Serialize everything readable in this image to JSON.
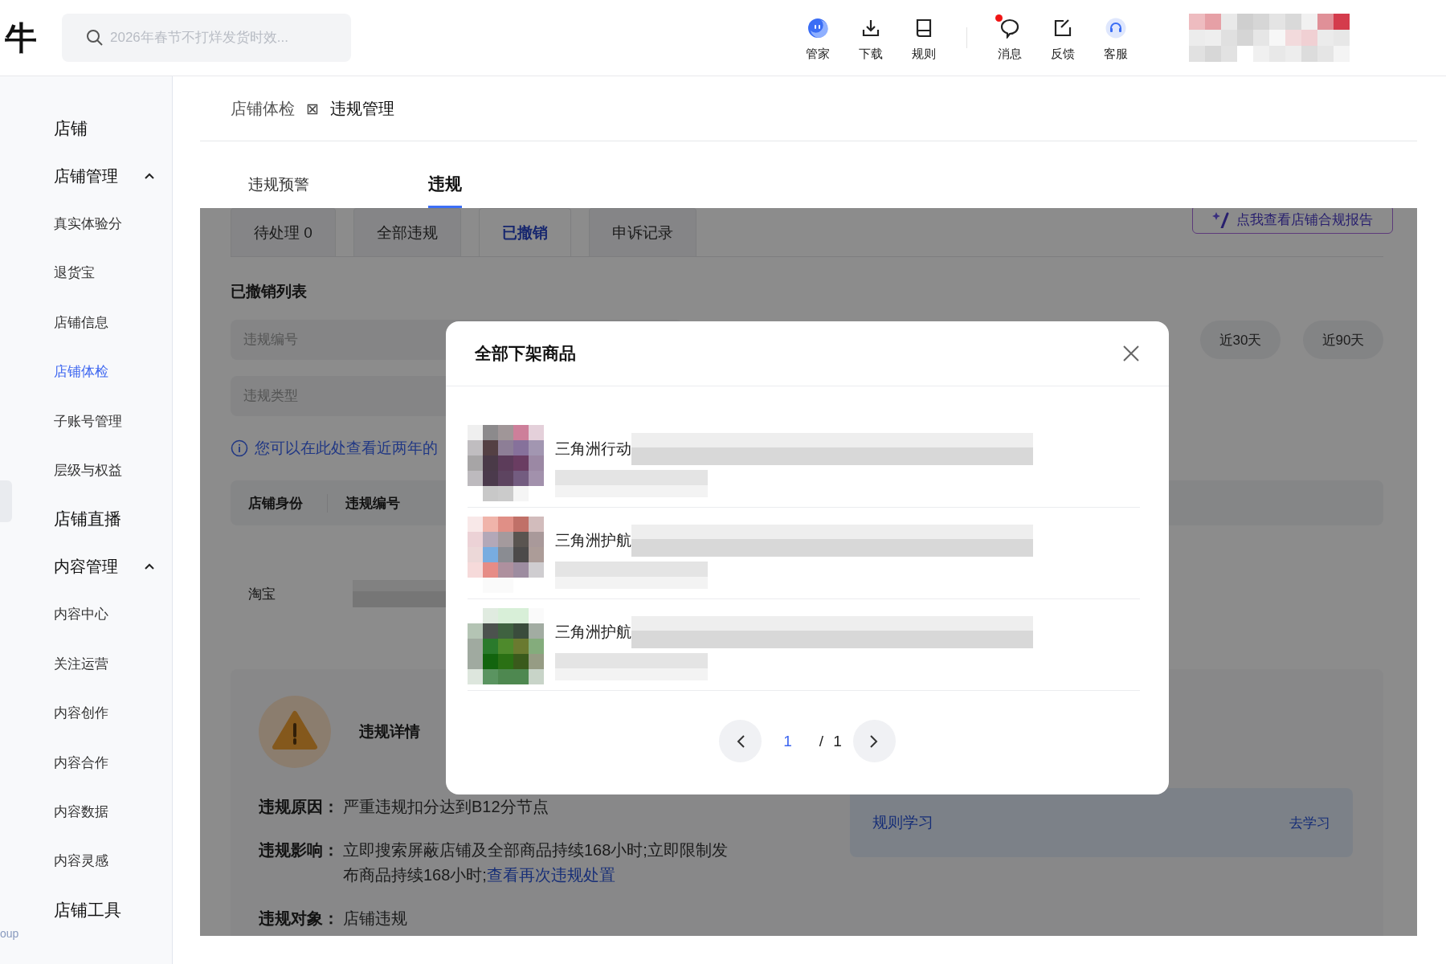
{
  "topbar": {
    "logo": "牛",
    "search": {
      "placeholder": "2026年春节不打烊发货时效..."
    },
    "tools": [
      {
        "label": "管家",
        "unread": false
      },
      {
        "label": "下载",
        "unread": false
      },
      {
        "label": "规则",
        "unread": false
      },
      {
        "label": "消息",
        "unread": true
      },
      {
        "label": "反馈",
        "unread": false
      },
      {
        "label": "客服",
        "unread": false
      }
    ]
  },
  "sidebar": {
    "items": [
      {
        "kind": "section",
        "label": "店铺"
      },
      {
        "kind": "group",
        "label": "店铺管理",
        "expanded": true,
        "children": [
          {
            "label": "真实体验分",
            "selected": false
          },
          {
            "label": "退货宝",
            "selected": false
          },
          {
            "label": "店铺信息",
            "selected": false
          },
          {
            "label": "店铺体检",
            "selected": true
          },
          {
            "label": "子账号管理",
            "selected": false
          },
          {
            "label": "层级与权益",
            "selected": false
          }
        ]
      },
      {
        "kind": "section",
        "label": "店铺直播"
      },
      {
        "kind": "group",
        "label": "内容管理",
        "expanded": true,
        "children": [
          {
            "label": "内容中心",
            "selected": false
          },
          {
            "label": "关注运营",
            "selected": false
          },
          {
            "label": "内容创作",
            "selected": false
          },
          {
            "label": "内容合作",
            "selected": false
          },
          {
            "label": "内容数据",
            "selected": false
          },
          {
            "label": "内容灵感",
            "selected": false
          }
        ]
      },
      {
        "kind": "section",
        "label": "店铺工具"
      }
    ],
    "edge_text": "oup"
  },
  "breadcrumb": {
    "items": [
      "店铺体检",
      "违规管理"
    ],
    "separator": "⊠"
  },
  "tabs": [
    {
      "label": "违规预警",
      "selected": false
    },
    {
      "label": "违规",
      "selected": true
    }
  ],
  "subtabs": [
    {
      "label": "待处理 0",
      "selected": false
    },
    {
      "label": "全部违规",
      "selected": false
    },
    {
      "label": "已撤销",
      "selected": true
    },
    {
      "label": "申诉记录",
      "selected": false
    }
  ],
  "report_button": "点我查看店铺合规报告",
  "list_title": "已撤销列表",
  "filters": [
    {
      "placeholder": "违规编号"
    },
    {
      "placeholder": "违规类型"
    }
  ],
  "date_buttons": [
    "近30天",
    "近90天"
  ],
  "notice": "您可以在此处查看近两年的",
  "table": {
    "columns": [
      "店铺身份",
      "违规编号"
    ],
    "rows": [
      {
        "cells": [
          "淘宝"
        ]
      }
    ]
  },
  "detail": {
    "title": "违规详情",
    "fields": [
      {
        "label": "违规原因：",
        "value": "严重违规扣分达到B12分节点"
      },
      {
        "label": "违规影响：",
        "value": "立即搜索屏蔽店铺及全部商品持续168小时;立即限制发布商品持续168小时;",
        "link": "查看再次违规处置"
      },
      {
        "label": "违规对象：",
        "value": "店铺违规"
      }
    ],
    "learn": {
      "title": "规则学习",
      "action": "去学习"
    }
  },
  "modal": {
    "title": "全部下架商品",
    "products": [
      {
        "title": "三角洲行动"
      },
      {
        "title": "三角洲护航"
      },
      {
        "title": "三角洲护航"
      }
    ],
    "pagination": {
      "current": "1",
      "separator": "/",
      "total": "1"
    }
  }
}
